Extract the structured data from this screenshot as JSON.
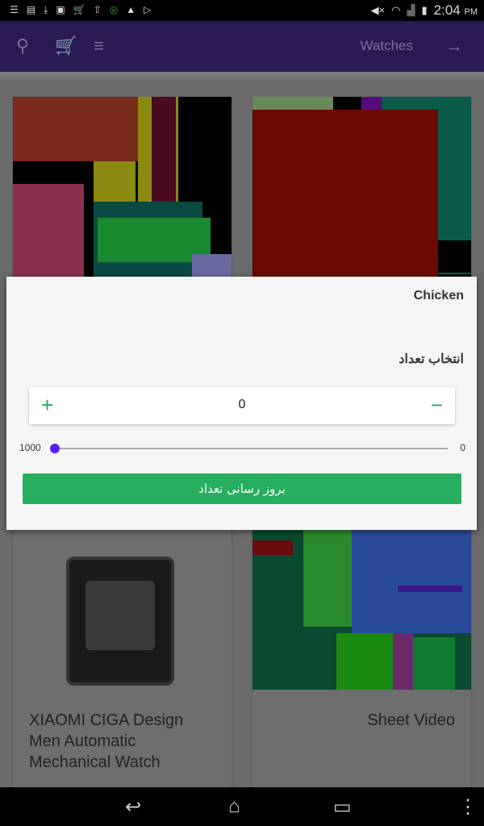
{
  "status_bar": {
    "time": "2:04",
    "ampm": "PM",
    "left_icons": [
      "menu-icon",
      "store-icon",
      "download-icon",
      "image-icon",
      "cart-icon",
      "upload-icon",
      "4g-icon",
      "warning-icon",
      "play-store-icon"
    ],
    "right_icons": [
      "mute-icon",
      "wifi-icon",
      "signal-icon",
      "battery-icon"
    ]
  },
  "app_bar": {
    "title": "Watches",
    "icons": [
      "search-icon",
      "cart-icon",
      "sort-icon",
      "arrow-forward-icon"
    ]
  },
  "products": [
    {
      "title": "XIAOMI CIGA Design Men Automatic Mechanical Watch"
    },
    {
      "title": "Sheet Video"
    }
  ],
  "dialog": {
    "title": "Chicken",
    "label": "انتخاب تعداد",
    "stepper": {
      "value": "0",
      "plus": "+",
      "minus": "−"
    },
    "slider": {
      "min_label": "1000",
      "max_label": "0",
      "value": 0
    },
    "update_button": "بروز رسانی تعداد",
    "accent": "#27ae60",
    "slider_color": "#5b1ff5"
  }
}
